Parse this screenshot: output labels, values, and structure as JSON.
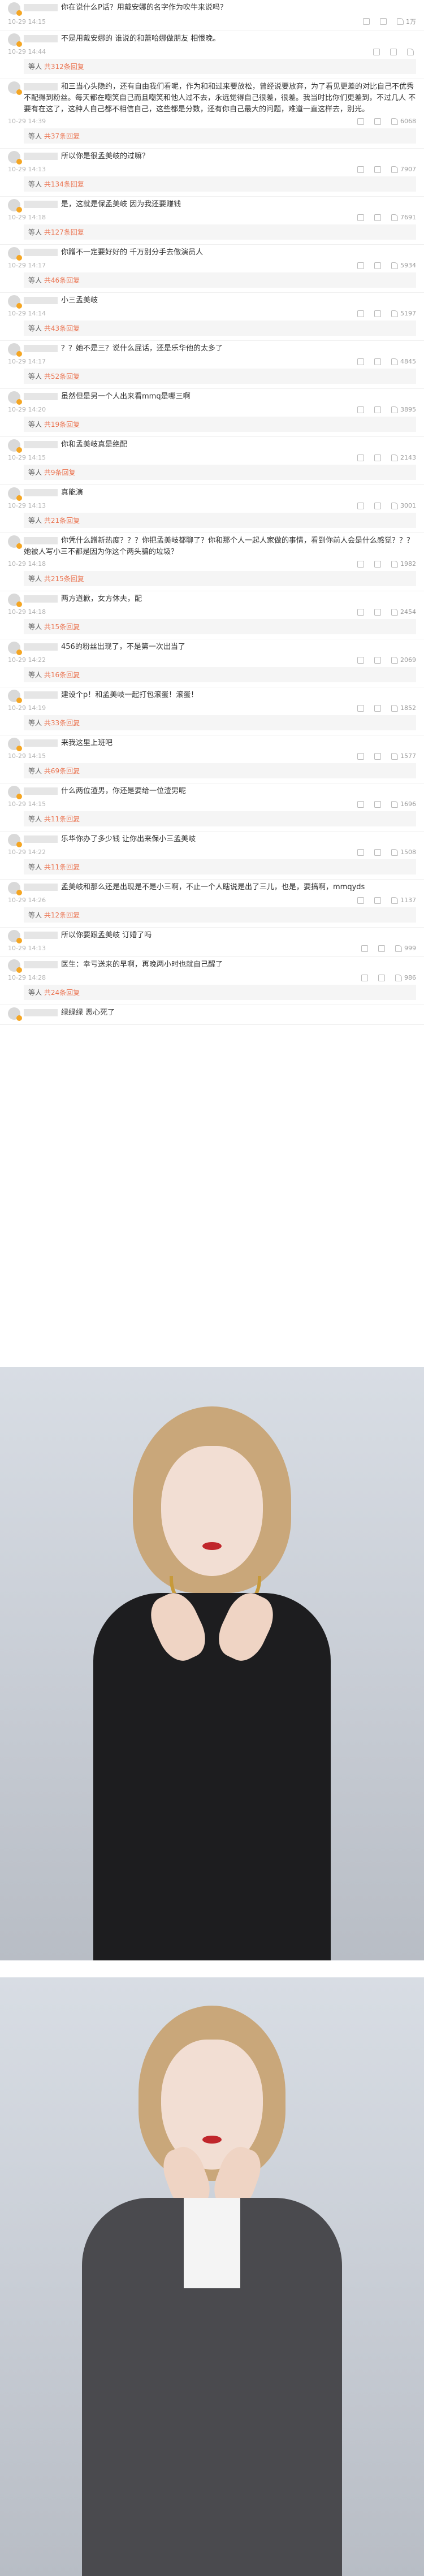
{
  "comments": [
    {
      "text": "你在说什么P话？用戴安娜的名字作为吹牛来说吗？",
      "time": "10-29 14:15",
      "likes": "1万"
    },
    {
      "text": "不是用戴安娜的 谁说的和蕾哈娜做朋友 相恨晚。",
      "time": "10-29 14:44",
      "likes": "",
      "reply": "共312条回复"
    },
    {
      "text": "和三当心头隐约，还有自由我们看呢，作为和和过来要放松，曾经说要放弃，为了看见更差的对比自己不优秀不配得到粉丝。每天都在嘲笑自己而且嘲笑和他人过不去，永远觉得自己很差，很差。我当时比你们更差到，不过几人 不要有在这了，这种人自己都不相信自己，这些都是分数，还有你自己最大的问题，难道一直这样去，别光。",
      "time": "10-29 14:39",
      "likes": "6068",
      "reply": "共37条回复"
    },
    {
      "text": "所以你是很孟美岐的过嘛？",
      "time": "10-29 14:13",
      "likes": "7907",
      "reply": "共134条回复"
    },
    {
      "text": "是，这就是保孟美岐 因为我还要赚钱",
      "time": "10-29 14:18",
      "likes": "7691",
      "reply": "共127条回复"
    },
    {
      "text": "你蹭不一定要好好的 千万别分手去做演员人",
      "time": "10-29 14:17",
      "likes": "5934",
      "reply": "共46条回复"
    },
    {
      "text": "小三孟美岐",
      "time": "10-29 14:14",
      "likes": "5197",
      "reply": "共43条回复"
    },
    {
      "text": "？？她不是三？说什么屁话，还是乐华他的太多了",
      "time": "10-29 14:17",
      "likes": "4845",
      "reply": "共52条回复"
    },
    {
      "text": "虽然但是另一个人出来看mmq是哪三啊",
      "time": "10-29 14:20",
      "likes": "3895",
      "reply": "共19条回复"
    },
    {
      "text": "你和孟美岐真是绝配",
      "time": "10-29 14:15",
      "likes": "2143",
      "reply": "共9条回复"
    },
    {
      "text": "真能演",
      "time": "10-29 14:13",
      "likes": "3001",
      "reply": "共21条回复"
    },
    {
      "text": "你凭什么蹭新热度？？？你把孟美岐都聊了？你和那个人一起人家做的事情，看到你前人会是什么感觉？？？她被人写小三不都是因为你这个两头骗的垃圾？",
      "time": "10-29 14:18",
      "likes": "1982",
      "reply": "共215条回复"
    },
    {
      "text": "两方道歉，女方休夫，配",
      "time": "10-29 14:18",
      "likes": "2454",
      "reply": "共15条回复"
    },
    {
      "text": "456的粉丝出现了，不是第一次出当了",
      "time": "10-29 14:22",
      "likes": "2069",
      "reply": "共16条回复"
    },
    {
      "text": "建设个p！和孟美岐一起打包滚蛋！滚蛋！",
      "time": "10-29 14:19",
      "likes": "1852",
      "reply": "共33条回复"
    },
    {
      "text": "来我这里上班吧",
      "time": "10-29 14:15",
      "likes": "1577",
      "reply": "共69条回复"
    },
    {
      "text": "什么两位渣男，你还是要给一位渣男呢",
      "time": "10-29 14:15",
      "likes": "1696",
      "reply": "共11条回复"
    },
    {
      "text": "乐华你办了多少钱 让你出来保小三孟美岐",
      "time": "10-29 14:22",
      "likes": "1508",
      "reply": "共11条回复"
    },
    {
      "text": "孟美岐和那么还是出现是不是小三啊，不止一个人瞎说是出了三儿，也是，要搞啊，mmqyds",
      "time": "10-29 14:26",
      "likes": "1137",
      "reply": "共12条回复"
    },
    {
      "text": "所以你要跟孟美岐 订婚了吗",
      "time": "10-29 14:13",
      "likes": "999",
      "reply": ""
    },
    {
      "text": "医生：幸亏送来的早啊，再晚两小时也就自己醒了",
      "time": "10-29 14:28",
      "likes": "986",
      "reply": "共24条回复"
    },
    {
      "text": "绿绿绿 恶心死了",
      "time": "",
      "likes": "",
      "reply": ""
    }
  ],
  "reply_prefix": "等人"
}
